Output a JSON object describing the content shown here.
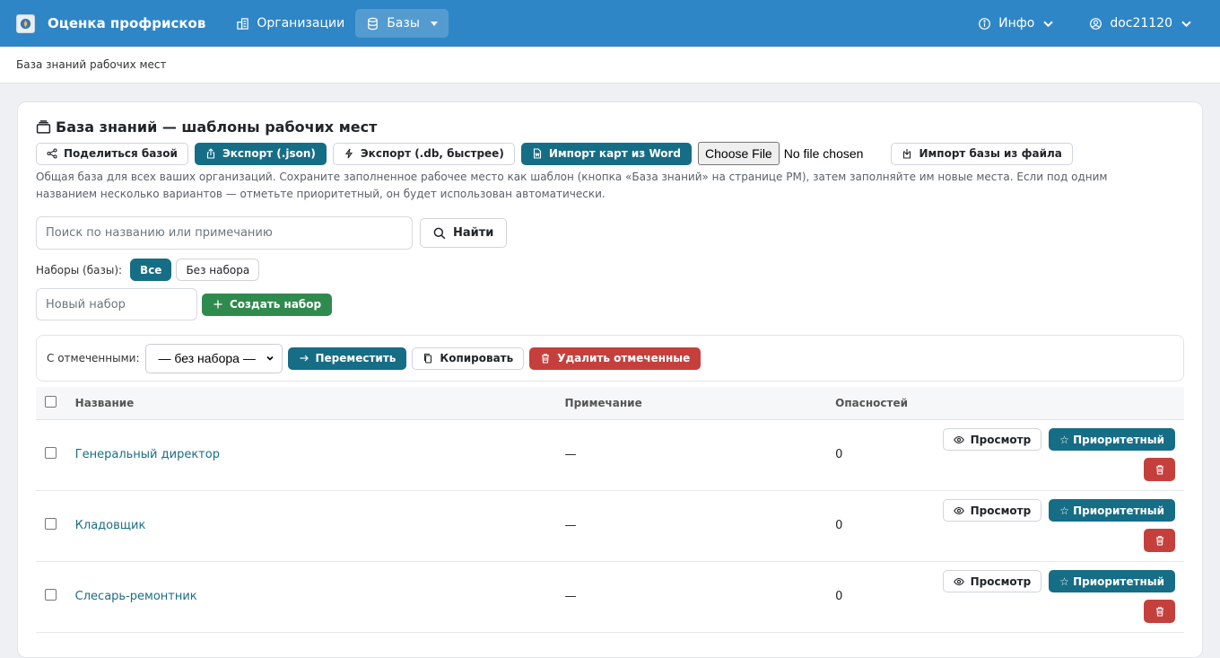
{
  "navbar": {
    "brand": "Оценка профрисков",
    "items": [
      {
        "label": "Организации",
        "icon": "building-icon"
      },
      {
        "label": "Базы",
        "icon": "database-icon"
      }
    ],
    "info": "Инфо",
    "user": "doc21120"
  },
  "breadcrumb": "База знаний рабочих мест",
  "card": {
    "title": "База знаний — шаблоны рабочих мест",
    "toolbar": {
      "share": "Поделиться базой",
      "export_json": "Экспорт (.json)",
      "export_db": "Экспорт (.db, быстрее)",
      "import_word": "Импорт карт из Word",
      "choose_file": "Choose File",
      "no_file": "No file chosen",
      "import_base": "Импорт базы из файла"
    },
    "description": "Общая база для всех ваших организаций. Сохраните заполненное рабочее место как шаблон (кнопка «База знаний» на странице РМ), затем заполняйте им новые места. Если под одним названием несколько вариантов — отметьте приоритетный, он будет использован автоматически.",
    "search": {
      "placeholder": "Поиск по названию или примечанию",
      "button": "Найти"
    },
    "sets": {
      "label": "Наборы (базы):",
      "all": "Все",
      "none": "Без набора"
    },
    "new_set": {
      "placeholder": "Новый набор",
      "button": "Создать набор"
    },
    "bulk": {
      "label": "С отмеченными:",
      "select_value": "— без набора —",
      "move": "Переместить",
      "copy": "Копировать",
      "delete": "Удалить отмеченные"
    },
    "table": {
      "headers": {
        "name": "Название",
        "note": "Примечание",
        "hazards": "Опасностей"
      },
      "view_label": "Просмотр",
      "priority_label": "☆ Приоритетный",
      "rows": [
        {
          "name": "Генеральный директор",
          "note": "—",
          "hazards": "0"
        },
        {
          "name": "Кладовщик",
          "note": "—",
          "hazards": "0"
        },
        {
          "name": "Слесарь-ремонтник",
          "note": "—",
          "hazards": "0"
        }
      ]
    }
  }
}
